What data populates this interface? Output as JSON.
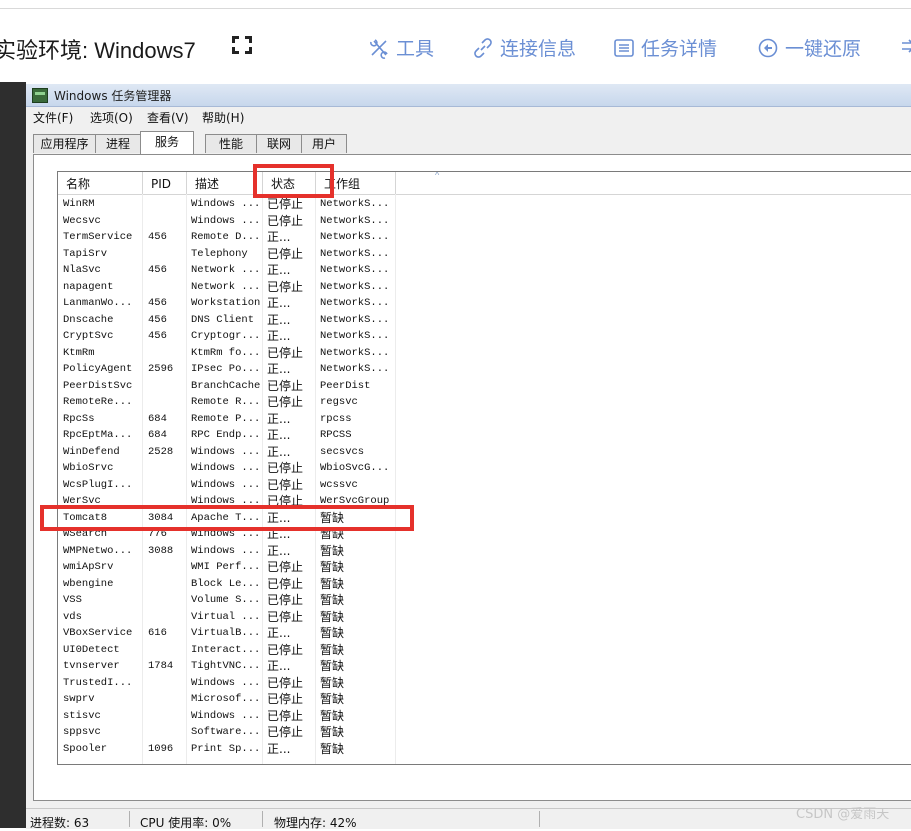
{
  "toolbar": {
    "env_title": "实验环境: Windows7",
    "tools": [
      {
        "label": "工具",
        "icon": "tools-icon"
      },
      {
        "label": "连接信息",
        "icon": "link-icon"
      },
      {
        "label": "任务详情",
        "icon": "task-list-icon"
      },
      {
        "label": "一键还原",
        "icon": "restore-icon"
      }
    ],
    "accent_color": "#6b8fd4"
  },
  "window": {
    "title": "Windows 任务管理器",
    "menu": [
      "文件(F)",
      "选项(O)",
      "查看(V)",
      "帮助(H)"
    ],
    "tabs": [
      "应用程序",
      "进程",
      "服务",
      "性能",
      "联网",
      "用户"
    ],
    "active_tab": "服务"
  },
  "services": {
    "columns": [
      "名称",
      "PID",
      "描述",
      "状态",
      "工作组"
    ],
    "rows": [
      [
        "WinRM",
        "",
        "Windows ...",
        "已停止",
        "NetworkS..."
      ],
      [
        "Wecsvc",
        "",
        "Windows ...",
        "已停止",
        "NetworkS..."
      ],
      [
        "TermService",
        "456",
        "Remote D...",
        "正...",
        "NetworkS..."
      ],
      [
        "TapiSrv",
        "",
        "Telephony",
        "已停止",
        "NetworkS..."
      ],
      [
        "NlaSvc",
        "456",
        "Network ...",
        "正...",
        "NetworkS..."
      ],
      [
        "napagent",
        "",
        "Network ...",
        "已停止",
        "NetworkS..."
      ],
      [
        "LanmanWo...",
        "456",
        "Workstation",
        "正...",
        "NetworkS..."
      ],
      [
        "Dnscache",
        "456",
        "DNS Client",
        "正...",
        "NetworkS..."
      ],
      [
        "CryptSvc",
        "456",
        "Cryptogr...",
        "正...",
        "NetworkS..."
      ],
      [
        "KtmRm",
        "",
        "KtmRm fo...",
        "已停止",
        "NetworkS..."
      ],
      [
        "PolicyAgent",
        "2596",
        "IPsec Po...",
        "正...",
        "NetworkS..."
      ],
      [
        "PeerDistSvc",
        "",
        "BranchCache",
        "已停止",
        "PeerDist"
      ],
      [
        "RemoteRe...",
        "",
        "Remote R...",
        "已停止",
        "regsvc"
      ],
      [
        "RpcSs",
        "684",
        "Remote P...",
        "正...",
        "rpcss"
      ],
      [
        "RpcEptMa...",
        "684",
        "RPC Endp...",
        "正...",
        "RPCSS"
      ],
      [
        "WinDefend",
        "2528",
        "Windows ...",
        "正...",
        "secsvcs"
      ],
      [
        "WbioSrvc",
        "",
        "Windows ...",
        "已停止",
        "WbioSvcG..."
      ],
      [
        "WcsPlugI...",
        "",
        "Windows ...",
        "已停止",
        "wcssvc"
      ],
      [
        "WerSvc",
        "",
        "Windows ...",
        "已停止",
        "WerSvcGroup"
      ],
      [
        "Tomcat8",
        "3084",
        "Apache T...",
        "正...",
        "暂缺"
      ],
      [
        "WSearch",
        "776",
        "Windows ...",
        "正...",
        "暂缺"
      ],
      [
        "WMPNetwo...",
        "3088",
        "Windows ...",
        "正...",
        "暂缺"
      ],
      [
        "wmiApSrv",
        "",
        "WMI Perf...",
        "已停止",
        "暂缺"
      ],
      [
        "wbengine",
        "",
        "Block Le...",
        "已停止",
        "暂缺"
      ],
      [
        "VSS",
        "",
        "Volume S...",
        "已停止",
        "暂缺"
      ],
      [
        "vds",
        "",
        "Virtual ...",
        "已停止",
        "暂缺"
      ],
      [
        "VBoxService",
        "616",
        "VirtualB...",
        "正...",
        "暂缺"
      ],
      [
        "UI0Detect",
        "",
        "Interact...",
        "已停止",
        "暂缺"
      ],
      [
        "tvnserver",
        "1784",
        "TightVNC...",
        "正...",
        "暂缺"
      ],
      [
        "TrustedI...",
        "",
        "Windows ...",
        "已停止",
        "暂缺"
      ],
      [
        "swprv",
        "",
        "Microsof...",
        "已停止",
        "暂缺"
      ],
      [
        "stisvc",
        "",
        "Windows ...",
        "已停止",
        "暂缺"
      ],
      [
        "sppsvc",
        "",
        "Software...",
        "已停止",
        "暂缺"
      ],
      [
        "Spooler",
        "1096",
        "Print Sp...",
        "正...",
        "暂缺"
      ]
    ]
  },
  "statusbar": {
    "processes": "进程数: 63",
    "cpu": "CPU 使用率: 0%",
    "memory": "物理内存: 42%"
  },
  "watermark": "CSDN @爱雨天",
  "highlight_color": "#e5312b"
}
